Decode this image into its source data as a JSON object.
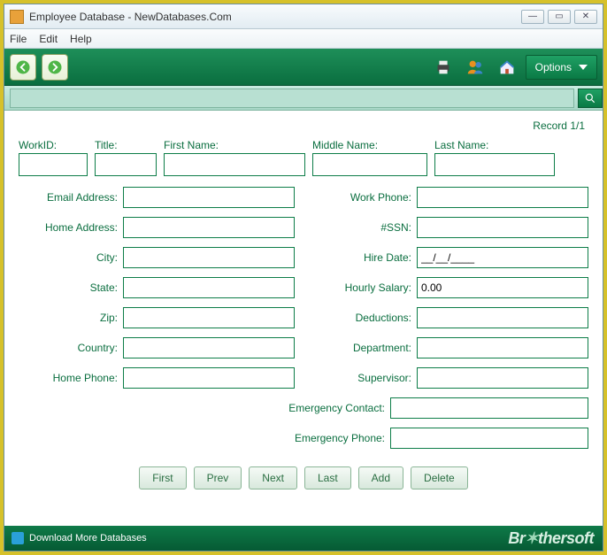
{
  "window": {
    "title": "Employee Database - NewDatabases.Com"
  },
  "menu": {
    "file": "File",
    "edit": "Edit",
    "help": "Help"
  },
  "toolbar": {
    "options_label": "Options"
  },
  "status": {
    "record": "Record 1/1"
  },
  "labels": {
    "workid": "WorkID:",
    "title": "Title:",
    "first_name": "First Name:",
    "middle_name": "Middle Name:",
    "last_name": "Last Name:",
    "email": "Email Address:",
    "home_address": "Home Address:",
    "city": "City:",
    "state": "State:",
    "zip": "Zip:",
    "country": "Country:",
    "home_phone": "Home Phone:",
    "work_phone": "Work Phone:",
    "ssn": "#SSN:",
    "hire_date": "Hire Date:",
    "hourly_salary": "Hourly Salary:",
    "deductions": "Deductions:",
    "department": "Department:",
    "supervisor": "Supervisor:",
    "emergency_contact": "Emergency Contact:",
    "emergency_phone": "Emergency Phone:"
  },
  "values": {
    "workid": "",
    "title": "",
    "first_name": "",
    "middle_name": "",
    "last_name": "",
    "email": "",
    "home_address": "",
    "city": "",
    "state": "",
    "zip": "",
    "country": "",
    "home_phone": "",
    "work_phone": "",
    "ssn": "",
    "hire_date": "__/__/____",
    "hourly_salary": "0.00",
    "deductions": "",
    "department": "",
    "supervisor": "",
    "emergency_contact": "",
    "emergency_phone": ""
  },
  "nav": {
    "first": "First",
    "prev": "Prev",
    "next": "Next",
    "last": "Last",
    "add": "Add",
    "delete": "Delete"
  },
  "footer": {
    "download": "Download More Databases",
    "brand_a": "Br",
    "brand_b": "thersoft"
  }
}
